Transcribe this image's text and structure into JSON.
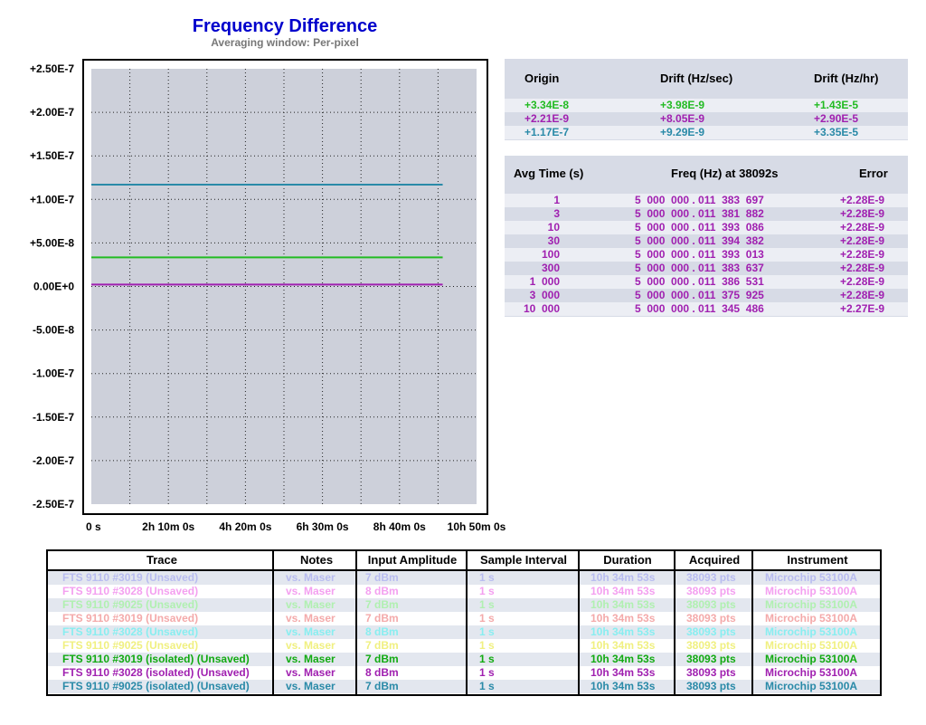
{
  "chart_data": {
    "type": "line",
    "title": "Frequency Difference",
    "subtitle": "Averaging window: Per-pixel",
    "xlabel": "",
    "ylabel": "",
    "x_tick_labels": [
      "0 s",
      "2h 10m 0s",
      "4h 20m 0s",
      "6h 30m 0s",
      "8h 40m 0s",
      "10h 50m 0s"
    ],
    "y_tick_labels": [
      "+2.50E-7",
      "+2.00E-7",
      "+1.50E-7",
      "+1.00E-7",
      "+5.00E-8",
      "0.00E+0",
      "-5.00E-8",
      "-1.00E-7",
      "-1.50E-7",
      "-2.00E-7",
      "-2.50E-7"
    ],
    "ylim": [
      -2.5e-07,
      2.5e-07
    ],
    "x_range_hours": [
      0,
      11.6
    ],
    "series": [
      {
        "name": "FTS 9110 #9025 (isolated) (Unsaved)",
        "color": "#2a8aa8",
        "x": [
          0,
          10.58
        ],
        "y": [
          1.17e-07,
          1.17e-07
        ]
      },
      {
        "name": "FTS 9110 #3019 (isolated) (Unsaved)",
        "color": "#22bb22",
        "x": [
          0,
          10.58
        ],
        "y": [
          3.34e-08,
          3.34e-08
        ]
      },
      {
        "name": "FTS 9110 #3028 (isolated) (Unsaved)",
        "color": "#a020b0",
        "x": [
          0,
          10.58
        ],
        "y": [
          2.21e-09,
          2.21e-09
        ]
      }
    ],
    "grid": true,
    "plot_background": "#cdd0da"
  },
  "drift": {
    "headers": [
      "Origin",
      "Drift (Hz/sec)",
      "Drift (Hz/hr)"
    ],
    "rows": [
      {
        "origin": "+3.34E-8",
        "drift_sec": "+3.98E-9",
        "drift_hr": "+1.43E-5",
        "color": "#22bb22"
      },
      {
        "origin": "+2.21E-9",
        "drift_sec": "+8.05E-9",
        "drift_hr": "+2.90E-5",
        "color": "#a020b0"
      },
      {
        "origin": "+1.17E-7",
        "drift_sec": "+9.29E-9",
        "drift_hr": "+3.35E-5",
        "color": "#2a8aa8"
      }
    ]
  },
  "adev": {
    "headers": [
      "Avg Time (s)",
      "Freq (Hz) at 38092s",
      "Error"
    ],
    "rows": [
      {
        "tau": "1",
        "freq": "5  000  000 . 011  383  697",
        "err": "+2.28E-9"
      },
      {
        "tau": "3",
        "freq": "5  000  000 . 011  381  882",
        "err": "+2.28E-9"
      },
      {
        "tau": "10",
        "freq": "5  000  000 . 011  393  086",
        "err": "+2.28E-9"
      },
      {
        "tau": "30",
        "freq": "5  000  000 . 011  394  382",
        "err": "+2.28E-9"
      },
      {
        "tau": "100",
        "freq": "5  000  000 . 011  393  013",
        "err": "+2.28E-9"
      },
      {
        "tau": "300",
        "freq": "5  000  000 . 011  383  637",
        "err": "+2.28E-9"
      },
      {
        "tau": "1  000",
        "freq": "5  000  000 . 011  386  531",
        "err": "+2.28E-9"
      },
      {
        "tau": "3  000",
        "freq": "5  000  000 . 011  375  925",
        "err": "+2.28E-9"
      },
      {
        "tau": "10  000",
        "freq": "5  000  000 . 011  345  486",
        "err": "+2.27E-9"
      }
    ]
  },
  "traces": {
    "headers": [
      "Trace",
      "Notes",
      "Input Amplitude",
      "Sample Interval",
      "Duration",
      "Acquired",
      "Instrument"
    ],
    "rows": [
      {
        "trace": "FTS 9110 #3019 (Unsaved)",
        "notes": "vs. Maser",
        "amp": "7 dBm",
        "interval": "1 s",
        "duration": "10h 34m 53s",
        "acquired": "38093 pts",
        "instrument": "Microchip 53100A",
        "color": "#b8bcf0"
      },
      {
        "trace": "FTS 9110 #3028 (Unsaved)",
        "notes": "vs. Maser",
        "amp": "8 dBm",
        "interval": "1 s",
        "duration": "10h 34m 53s",
        "acquired": "38093 pts",
        "instrument": "Microchip 53100A",
        "color": "#f4a0f0"
      },
      {
        "trace": "FTS 9110 #9025 (Unsaved)",
        "notes": "vs. Maser",
        "amp": "7 dBm",
        "interval": "1 s",
        "duration": "10h 34m 53s",
        "acquired": "38093 pts",
        "instrument": "Microchip 53100A",
        "color": "#b0f0b0"
      },
      {
        "trace": "FTS 9110 #3019 (Unsaved)",
        "notes": "vs. Maser",
        "amp": "7 dBm",
        "interval": "1 s",
        "duration": "10h 34m 53s",
        "acquired": "38093 pts",
        "instrument": "Microchip 53100A",
        "color": "#f4aaaa"
      },
      {
        "trace": "FTS 9110 #3028 (Unsaved)",
        "notes": "vs. Maser",
        "amp": "8 dBm",
        "interval": "1 s",
        "duration": "10h 34m 53s",
        "acquired": "38093 pts",
        "instrument": "Microchip 53100A",
        "color": "#88eef0"
      },
      {
        "trace": "FTS 9110 #9025 (Unsaved)",
        "notes": "vs. Maser",
        "amp": "7 dBm",
        "interval": "1 s",
        "duration": "10h 34m 53s",
        "acquired": "38093 pts",
        "instrument": "Microchip 53100A",
        "color": "#f0f080"
      },
      {
        "trace": "FTS 9110 #3019 (isolated) (Unsaved)",
        "notes": "vs. Maser",
        "amp": "7 dBm",
        "interval": "1 s",
        "duration": "10h 34m 53s",
        "acquired": "38093 pts",
        "instrument": "Microchip 53100A",
        "color": "#11aa11"
      },
      {
        "trace": "FTS 9110 #3028 (isolated) (Unsaved)",
        "notes": "vs. Maser",
        "amp": "8 dBm",
        "interval": "1 s",
        "duration": "10h 34m 53s",
        "acquired": "38093 pts",
        "instrument": "Microchip 53100A",
        "color": "#a020b0"
      },
      {
        "trace": "FTS 9110 #9025 (isolated) (Unsaved)",
        "notes": "vs. Maser",
        "amp": "7 dBm",
        "interval": "1 s",
        "duration": "10h 34m 53s",
        "acquired": "38093 pts",
        "instrument": "Microchip 53100A",
        "color": "#2a8aa8"
      }
    ]
  }
}
